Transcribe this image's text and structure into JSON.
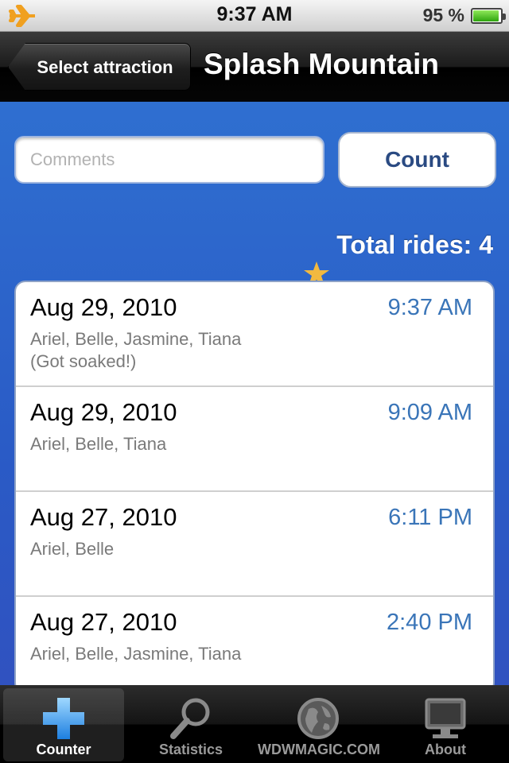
{
  "status_bar": {
    "time": "9:37 AM",
    "battery": "95 %"
  },
  "nav": {
    "back_label": "Select attraction",
    "title": "Splash Mountain"
  },
  "form": {
    "comments_placeholder": "Comments",
    "count_label": "Count"
  },
  "total": "Total rides: 4",
  "rides": [
    {
      "date": "Aug 29, 2010",
      "time": "9:37 AM",
      "names": "Ariel, Belle, Jasmine, Tiana",
      "comment": "(Got soaked!)"
    },
    {
      "date": "Aug 29, 2010",
      "time": "9:09 AM",
      "names": "Ariel, Belle, Tiana",
      "comment": ""
    },
    {
      "date": "Aug 27, 2010",
      "time": "6:11 PM",
      "names": "Ariel, Belle",
      "comment": ""
    },
    {
      "date": "Aug 27, 2010",
      "time": "2:40 PM",
      "names": "Ariel, Belle, Jasmine, Tiana",
      "comment": ""
    }
  ],
  "tabs": [
    {
      "label": "Counter",
      "icon": "plus-icon"
    },
    {
      "label": "Statistics",
      "icon": "magnifier-icon"
    },
    {
      "label": "WDWMAGIC.COM",
      "icon": "globe-icon"
    },
    {
      "label": "About",
      "icon": "monitor-icon"
    }
  ],
  "colors": {
    "nav_background": "#000000",
    "content_background": "#2d63c8",
    "time_accent": "#3a75b8"
  }
}
